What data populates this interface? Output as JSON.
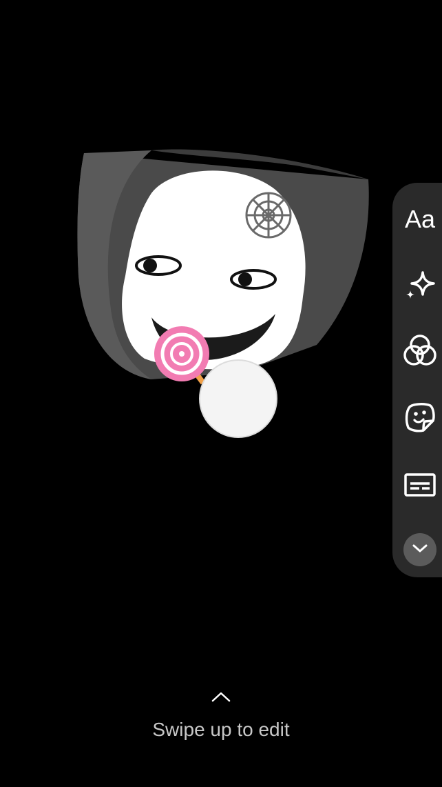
{
  "toolbar": {
    "text_tool_label": "Aa",
    "tools": [
      {
        "name": "text",
        "icon": "text-icon"
      },
      {
        "name": "effects",
        "icon": "sparkle-icon"
      },
      {
        "name": "filters",
        "icon": "filters-icon"
      },
      {
        "name": "stickers",
        "icon": "sticker-icon"
      },
      {
        "name": "captions",
        "icon": "captions-icon"
      },
      {
        "name": "more",
        "icon": "chevron-down-icon"
      }
    ]
  },
  "swipe_hint": {
    "icon": "chevron-up-icon",
    "label": "Swipe up to edit"
  },
  "colors": {
    "background": "#000000",
    "toolbar": "#2a2a2a",
    "expand_button": "#5b5b5b",
    "hint_text": "#c8c8c8"
  }
}
